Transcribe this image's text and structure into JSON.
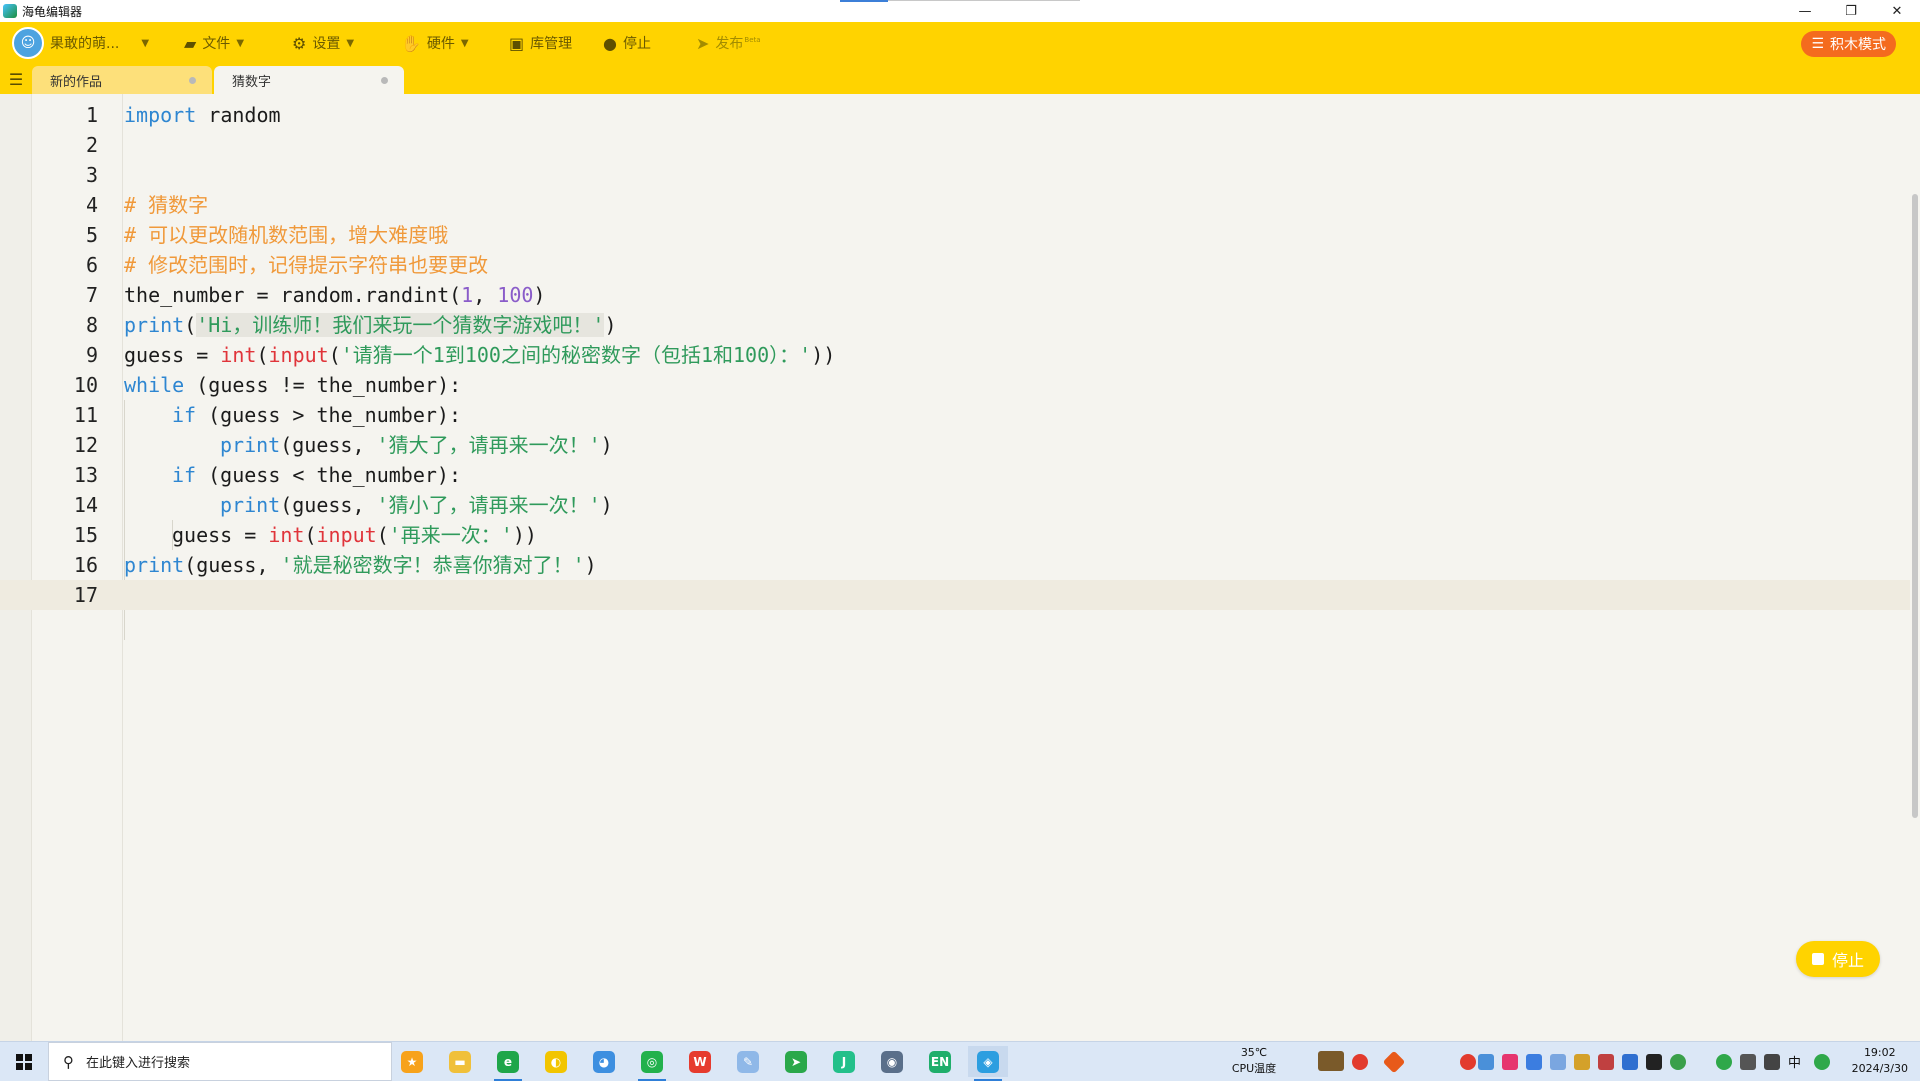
{
  "window": {
    "title": "海龟编辑器",
    "controls": {
      "minimize": "—",
      "restore": "❐",
      "close": "✕"
    }
  },
  "toolbar": {
    "user_label": "果敢的萌...",
    "file_label": "文件",
    "settings_label": "设置",
    "hardware_label": "硬件",
    "library_label": "库管理",
    "stop_label": "停止",
    "publish_label": "发布",
    "publish_badge": "Beta",
    "mode_button_label": "积木模式",
    "colors": {
      "bar": "#ffd300",
      "mode_button": "#f46b1e"
    }
  },
  "tabs": [
    {
      "label": "新的作品",
      "active": false
    },
    {
      "label": "猜数字",
      "active": true
    }
  ],
  "editor": {
    "line_numbers": [
      "1",
      "2",
      "3",
      "4",
      "5",
      "6",
      "7",
      "8",
      "9",
      "10",
      "11",
      "12",
      "13",
      "14",
      "15",
      "16",
      "17"
    ],
    "current_line": 17,
    "code": {
      "l1_kw": "import",
      "l1_rest": " random",
      "l4": "# 猜数字",
      "l5": "# 可以更改随机数范围，增大难度哦",
      "l6": "# 修改范围时，记得提示字符串也要更改",
      "l7_a": "the_number = random.randint(",
      "l7_n1": "1",
      "l7_b": ", ",
      "l7_n2": "100",
      "l7_c": ")",
      "l8_kw": "print",
      "l8_a": "(",
      "l8_str": "'Hi，训练师！我们来玩一个猜数字游戏吧！'",
      "l8_b": ")",
      "l9_a": "guess = ",
      "l9_int": "int",
      "l9_b": "(",
      "l9_input": "input",
      "l9_c": "(",
      "l9_str": "'请猜一个1到100之间的秘密数字（包括1和100）：'",
      "l9_d": "))",
      "l10_kw": "while",
      "l10_rest": " (guess != the_number):",
      "l11_kw": "if",
      "l11_rest": " (guess > the_number):",
      "l12_kw": "print",
      "l12_a": "(guess, ",
      "l12_str": "'猜大了，请再来一次！'",
      "l12_b": ")",
      "l13_kw": "if",
      "l13_rest": " (guess < the_number):",
      "l14_kw": "print",
      "l14_a": "(guess, ",
      "l14_str": "'猜小了，请再来一次！'",
      "l14_b": ")",
      "l15_a": "guess = ",
      "l15_int": "int",
      "l15_b": "(",
      "l15_input": "input",
      "l15_c": "(",
      "l15_str": "'再来一次：'",
      "l15_d": "))",
      "l16_kw": "print",
      "l16_a": "(guess, ",
      "l16_str": "'就是秘密数字！恭喜你猜对了！'",
      "l16_b": ")"
    },
    "syntax_colors": {
      "keyword": "#2e86d1",
      "builtin": "#e0343a",
      "number": "#8a5cc9",
      "string": "#2f9a5b",
      "comment": "#f0993a"
    },
    "float_stop_label": "停止"
  },
  "taskbar": {
    "search_placeholder": "在此键入进行搜索",
    "apps": [
      {
        "name": "star-app-icon",
        "color": "#f7a21b",
        "glyph": "★"
      },
      {
        "name": "file-explorer-icon",
        "color": "#f0c03a",
        "glyph": "▬"
      },
      {
        "name": "ie-browser-icon",
        "color": "#1fa64a",
        "glyph": "e"
      },
      {
        "name": "qq-browser-icon",
        "color": "#f2c500",
        "glyph": "◐"
      },
      {
        "name": "qq-icon",
        "color": "#3d8fe0",
        "glyph": "◕"
      },
      {
        "name": "wechat-icon",
        "color": "#22b14c",
        "glyph": "◎"
      },
      {
        "name": "wps-icon",
        "color": "#e63b2e",
        "glyph": "W"
      },
      {
        "name": "paint-icon",
        "color": "#8fb8e8",
        "glyph": "✎"
      },
      {
        "name": "feishu-send-icon",
        "color": "#2aa84a",
        "glyph": "➤"
      },
      {
        "name": "jetbrains-icon",
        "color": "#23c08a",
        "glyph": "J"
      },
      {
        "name": "camera-icon",
        "color": "#5a6f8a",
        "glyph": "◉"
      },
      {
        "name": "en-input-icon",
        "color": "#1fae6b",
        "glyph": "EN"
      },
      {
        "name": "turtle-editor-icon",
        "color": "#2c9ee0",
        "glyph": "◈"
      }
    ],
    "cpu_temp": "35℃",
    "cpu_label": "CPU温度",
    "ime_label": "中",
    "time": "19:02",
    "date": "2024/3/30"
  }
}
